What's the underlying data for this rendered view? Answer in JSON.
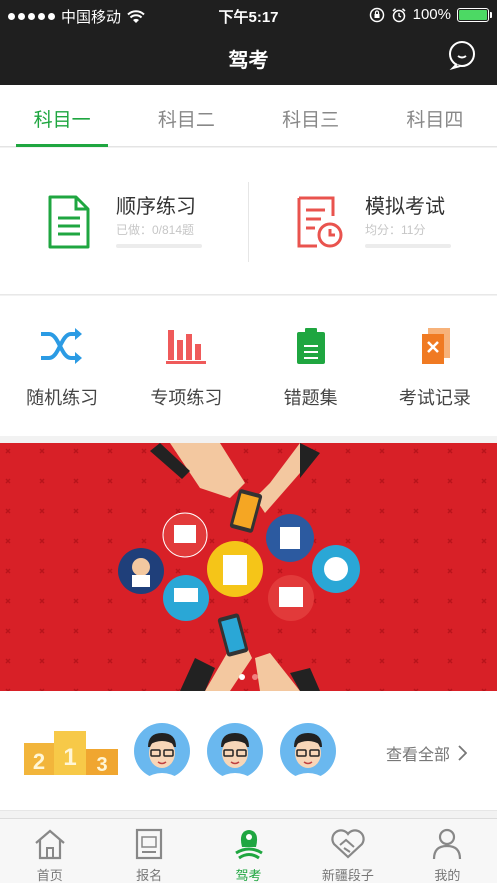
{
  "status_bar": {
    "carrier": "中国移动",
    "time": "下午5:17",
    "battery": "100%"
  },
  "header": {
    "title": "驾考"
  },
  "subject_tabs": [
    {
      "label": "科目一",
      "active": true
    },
    {
      "label": "科目二",
      "active": false
    },
    {
      "label": "科目三",
      "active": false
    },
    {
      "label": "科目四",
      "active": false
    }
  ],
  "practice": {
    "sequential": {
      "title": "顺序练习",
      "subtitle": "已做：0/814题",
      "progress": 0
    },
    "mock_exam": {
      "title": "模拟考试",
      "subtitle": "均分：11分",
      "progress": 0
    }
  },
  "quick_actions": [
    {
      "label": "随机练习",
      "icon": "shuffle-icon"
    },
    {
      "label": "专项练习",
      "icon": "bar-chart-icon"
    },
    {
      "label": "错题集",
      "icon": "clipboard-icon"
    },
    {
      "label": "考试记录",
      "icon": "exam-record-icon"
    }
  ],
  "banner": {
    "current_page": 1,
    "total_pages": 2
  },
  "ranking": {
    "podium": [
      "2",
      "1",
      "3"
    ],
    "view_all": "查看全部"
  },
  "tab_bar": [
    {
      "label": "首页",
      "icon": "home-icon",
      "active": false
    },
    {
      "label": "报名",
      "icon": "register-icon",
      "active": false
    },
    {
      "label": "驾考",
      "icon": "driving-test-icon",
      "active": true
    },
    {
      "label": "新疆段子",
      "icon": "handshake-icon",
      "active": false
    },
    {
      "label": "我的",
      "icon": "profile-icon",
      "active": false
    }
  ],
  "colors": {
    "accent": "#1fa640",
    "header_bg": "#1f1f1f",
    "banner_bg": "#d82027"
  }
}
